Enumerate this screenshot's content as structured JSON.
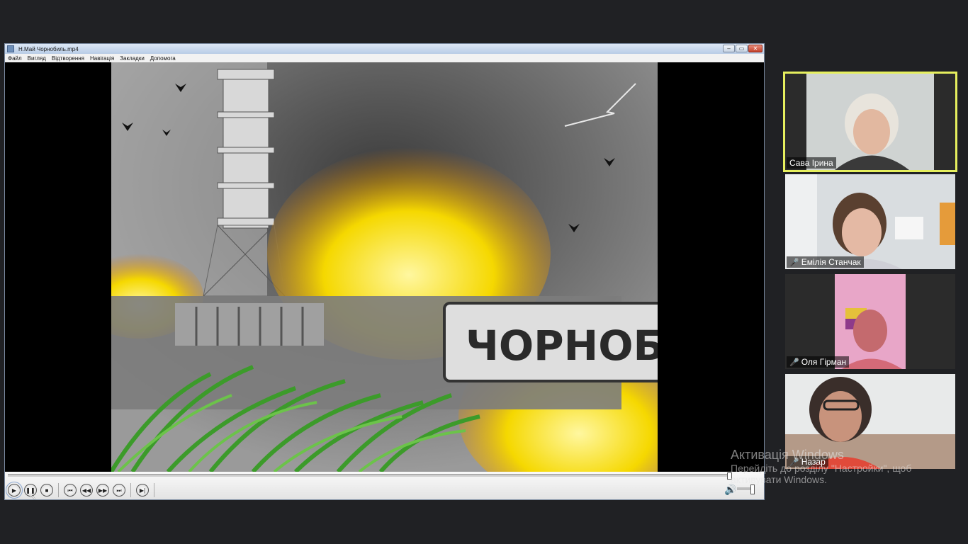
{
  "player": {
    "title": "Н.Май Чорнобиль.mp4",
    "menu": [
      "Файл",
      "Вигляд",
      "Відтворення",
      "Навігація",
      "Закладки",
      "Допомога"
    ],
    "window_buttons": {
      "minimize": "–",
      "restore": "▭",
      "close": "✕"
    },
    "video_sign_text": "ЧОРНОБИ",
    "controls": {
      "play": "▶",
      "pause": "❚❚",
      "stop": "■",
      "prev": "⏮",
      "rew": "◀◀",
      "fwd": "▶▶",
      "next": "⏭",
      "step": "▶|"
    },
    "playback_progress": 1.0,
    "volume_icon": "speaker-icon"
  },
  "participants": [
    {
      "name": "Сава Ірина",
      "active": true,
      "muted": false
    },
    {
      "name": "Емілія Станчак",
      "active": false,
      "muted": true
    },
    {
      "name": "Оля Гірман",
      "active": false,
      "muted": true
    },
    {
      "name": "Назар",
      "active": false,
      "muted": true
    }
  ],
  "watermark": {
    "title": "Активація Windows",
    "line1": "Перейдіть до розділу \"Настройки\", щоб",
    "line2": "активувати Windows."
  },
  "colors": {
    "active_speaker_border": "#e6ef5e",
    "mic_off": "#e0413a",
    "titlebar": "#b8cce6"
  }
}
